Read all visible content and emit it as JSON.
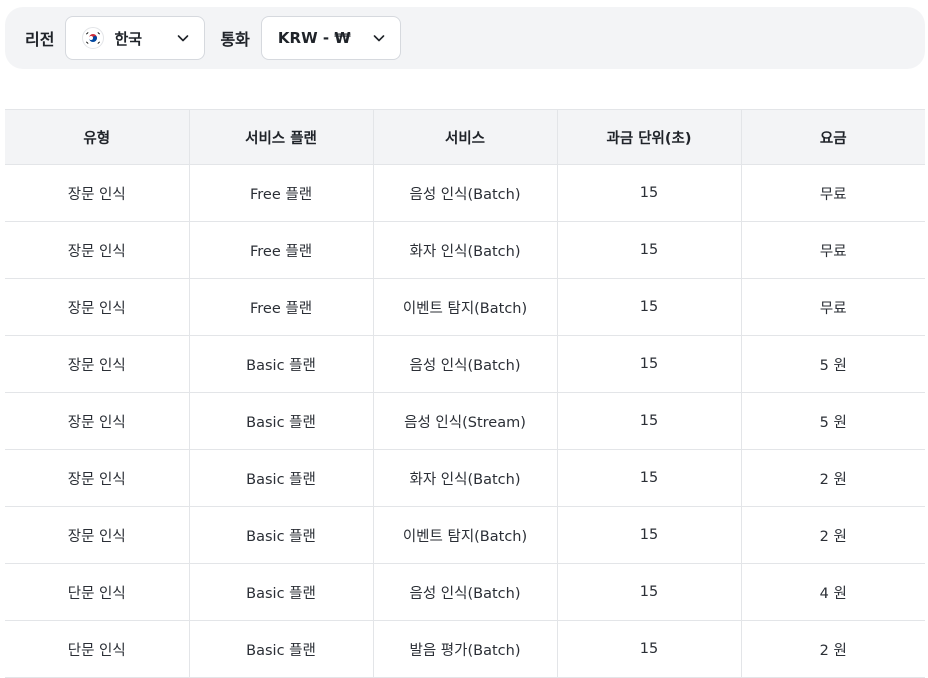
{
  "filters": {
    "region_label": "리전",
    "region_value": "한국",
    "region_flag_icon": "korea-flag-icon",
    "currency_label": "통화",
    "currency_value": "KRW - ₩"
  },
  "table": {
    "headers": [
      "유형",
      "서비스 플랜",
      "서비스",
      "과금 단위(초)",
      "요금"
    ],
    "rows": [
      [
        "장문 인식",
        "Free 플랜",
        "음성 인식(Batch)",
        "15",
        "무료"
      ],
      [
        "장문 인식",
        "Free 플랜",
        "화자 인식(Batch)",
        "15",
        "무료"
      ],
      [
        "장문 인식",
        "Free 플랜",
        "이벤트 탐지(Batch)",
        "15",
        "무료"
      ],
      [
        "장문 인식",
        "Basic 플랜",
        "음성 인식(Batch)",
        "15",
        "5 원"
      ],
      [
        "장문 인식",
        "Basic 플랜",
        "음성 인식(Stream)",
        "15",
        "5 원"
      ],
      [
        "장문 인식",
        "Basic 플랜",
        "화자 인식(Batch)",
        "15",
        "2 원"
      ],
      [
        "장문 인식",
        "Basic 플랜",
        "이벤트 탐지(Batch)",
        "15",
        "2 원"
      ],
      [
        "단문 인식",
        "Basic 플랜",
        "음성 인식(Batch)",
        "15",
        "4 원"
      ],
      [
        "단문 인식",
        "Basic 플랜",
        "발음 평가(Batch)",
        "15",
        "2 원"
      ]
    ]
  },
  "colors": {
    "panel_bg": "#f3f4f6",
    "border": "#e3e5e8",
    "flag_red": "#cd2e3a",
    "flag_blue": "#0047a0"
  }
}
